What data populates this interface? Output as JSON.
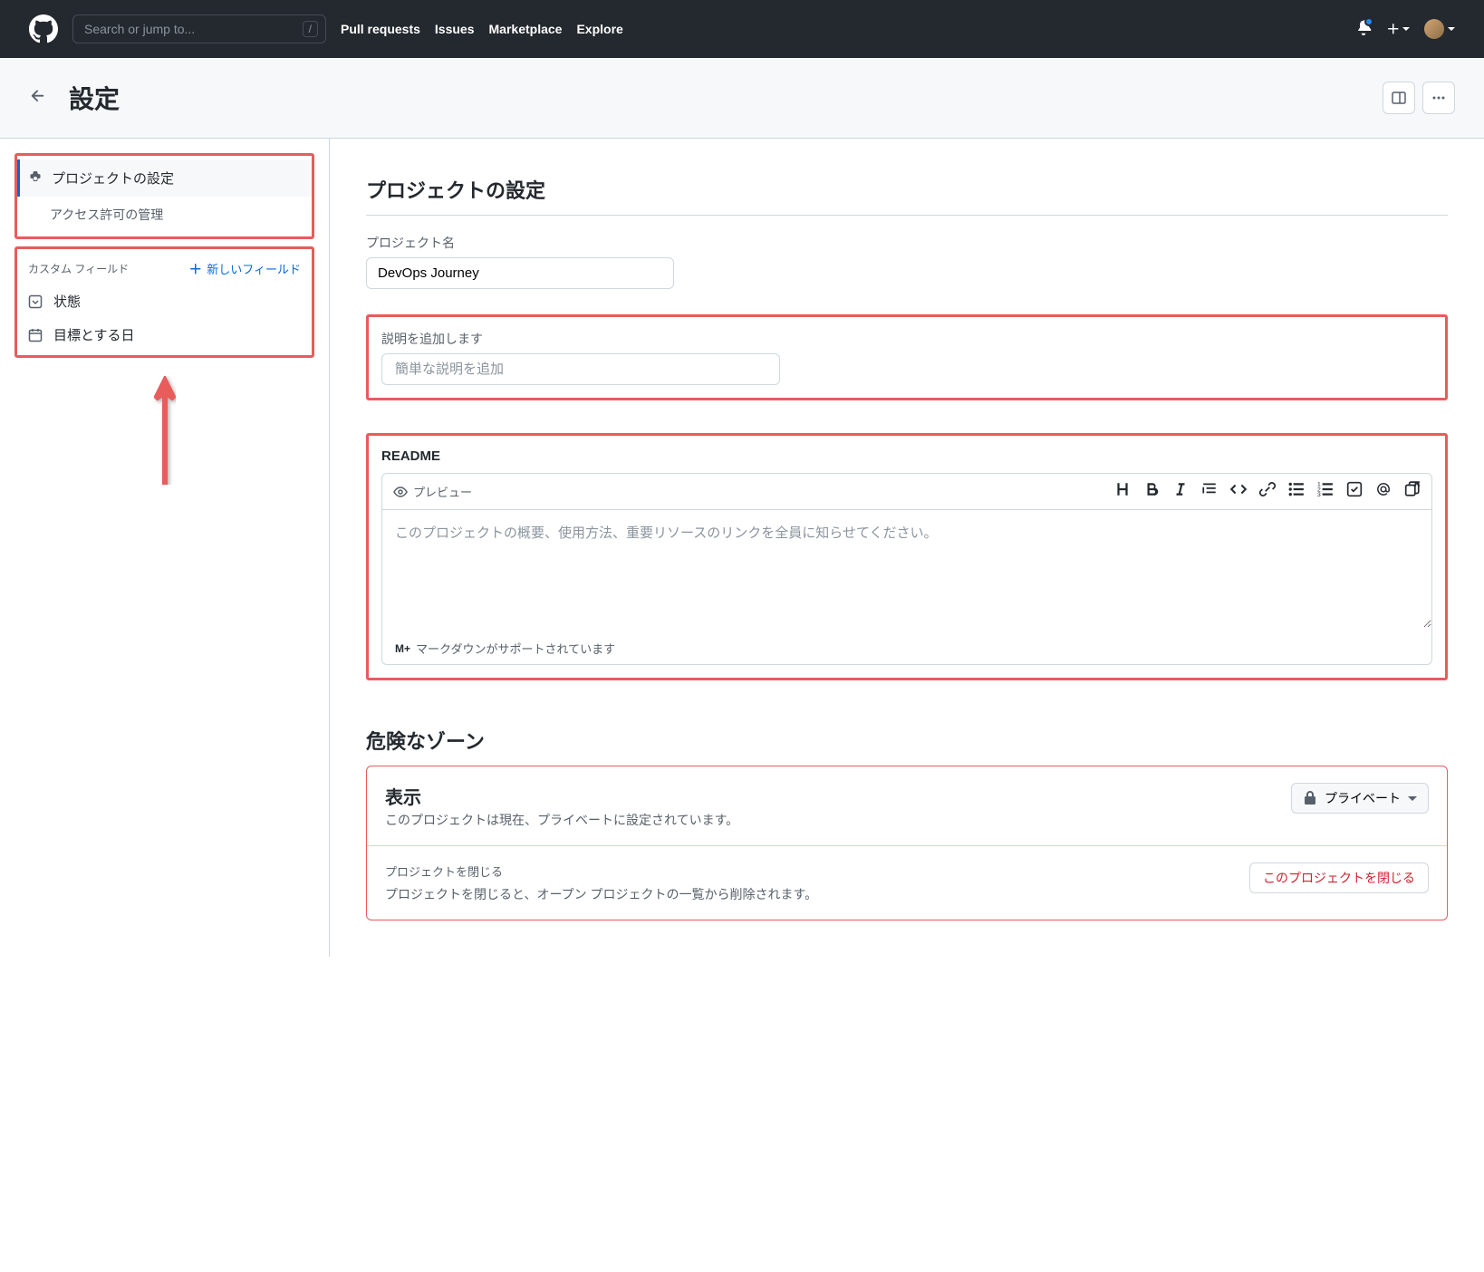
{
  "header": {
    "search_placeholder": "Search or jump to...",
    "search_key": "/",
    "nav": {
      "pull_requests": "Pull requests",
      "issues": "Issues",
      "marketplace": "Marketplace",
      "explore": "Explore"
    }
  },
  "page": {
    "title": "設定"
  },
  "sidebar": {
    "project_settings": "プロジェクトの設定",
    "manage_access": "アクセス許可の管理",
    "custom_fields_label": "カスタム フィールド",
    "new_field": "新しいフィールド",
    "field_status": "状態",
    "field_target_date": "目標とする日"
  },
  "main": {
    "heading": "プロジェクトの設定",
    "project_name_label": "プロジェクト名",
    "project_name_value": "DevOps Journey",
    "description_label": "説明を追加します",
    "description_placeholder": "簡単な説明を追加",
    "readme_label": "README",
    "preview_label": "プレビュー",
    "readme_placeholder": "このプロジェクトの概要、使用方法、重要リソースのリンクを全員に知らせてください。",
    "markdown_badge": "M+",
    "markdown_supported": "マークダウンがサポートされています",
    "danger_heading": "危険なゾーン",
    "visibility_title": "表示",
    "visibility_desc": "このプロジェクトは現在、プライベートに設定されています。",
    "private_btn": "プライベート",
    "close_project_label": "プロジェクトを閉じる",
    "close_project_desc": "プロジェクトを閉じると、オープン プロジェクトの一覧から削除されます。",
    "close_project_btn": "このプロジェクトを閉じる"
  }
}
